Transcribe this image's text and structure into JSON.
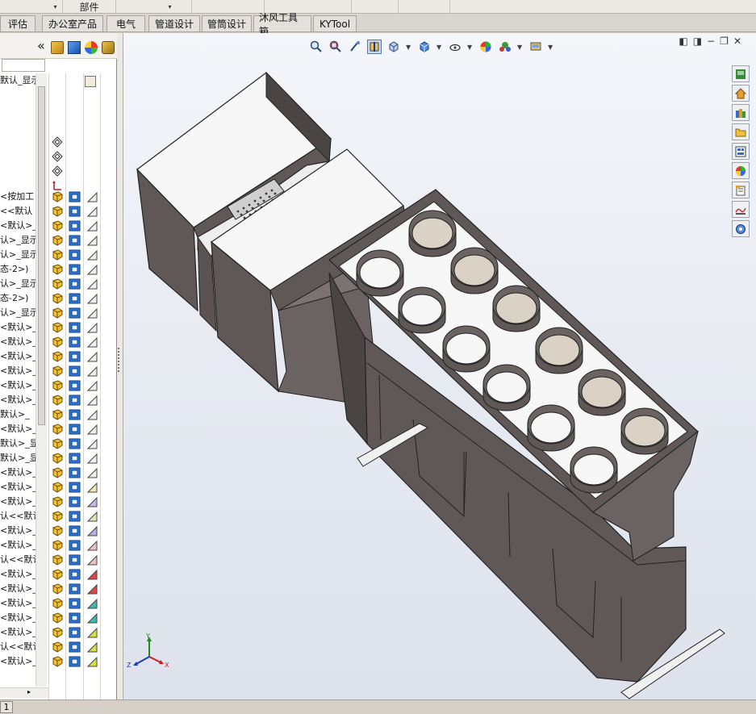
{
  "topstrip": {
    "label": "部件",
    "caret": "▾"
  },
  "tabs": [
    {
      "label": "评估"
    },
    {
      "label": "办公室产品"
    },
    {
      "label": "电气"
    },
    {
      "label": "管道设计"
    },
    {
      "label": "管筒设计"
    },
    {
      "label": "沐风工具箱"
    },
    {
      "label": "KYTool"
    }
  ],
  "left_panel": {
    "collapse_glyph": "«",
    "tree_rows": [
      "默认_显示",
      "<按加工",
      "<<默认",
      "<默认>_",
      "认>_显示",
      "认>_显示",
      "态-2>)",
      "认>_显示",
      "态-2>)",
      "认>_显示",
      "<默认>_",
      "<默认>_",
      "<默认>_",
      "<默认>_",
      "<默认>_",
      "<默认>_",
      "默认>_",
      "<默认>_",
      "默认>_显",
      "默认>_显",
      "<默认>_",
      "<默认>_",
      "<默认>_",
      "认<<默认",
      "<默认>_",
      "<默认>_",
      "认<<默认",
      "<默认>_",
      "<默认>_",
      "<默认>_",
      "<默认>_",
      "<默认>_",
      "认<<默认",
      "<默认>_"
    ],
    "status_label": "1"
  },
  "viewport": {
    "triad": {
      "x": "X",
      "y": "Y",
      "z": "Z"
    },
    "colors": {
      "body": "#5f5857",
      "body_dark": "#4a4443",
      "body_light": "#7a7372",
      "white_face": "#f7f7f7",
      "duct_inner": "#d9d2c5",
      "tray_top": "#eeeeee"
    }
  }
}
